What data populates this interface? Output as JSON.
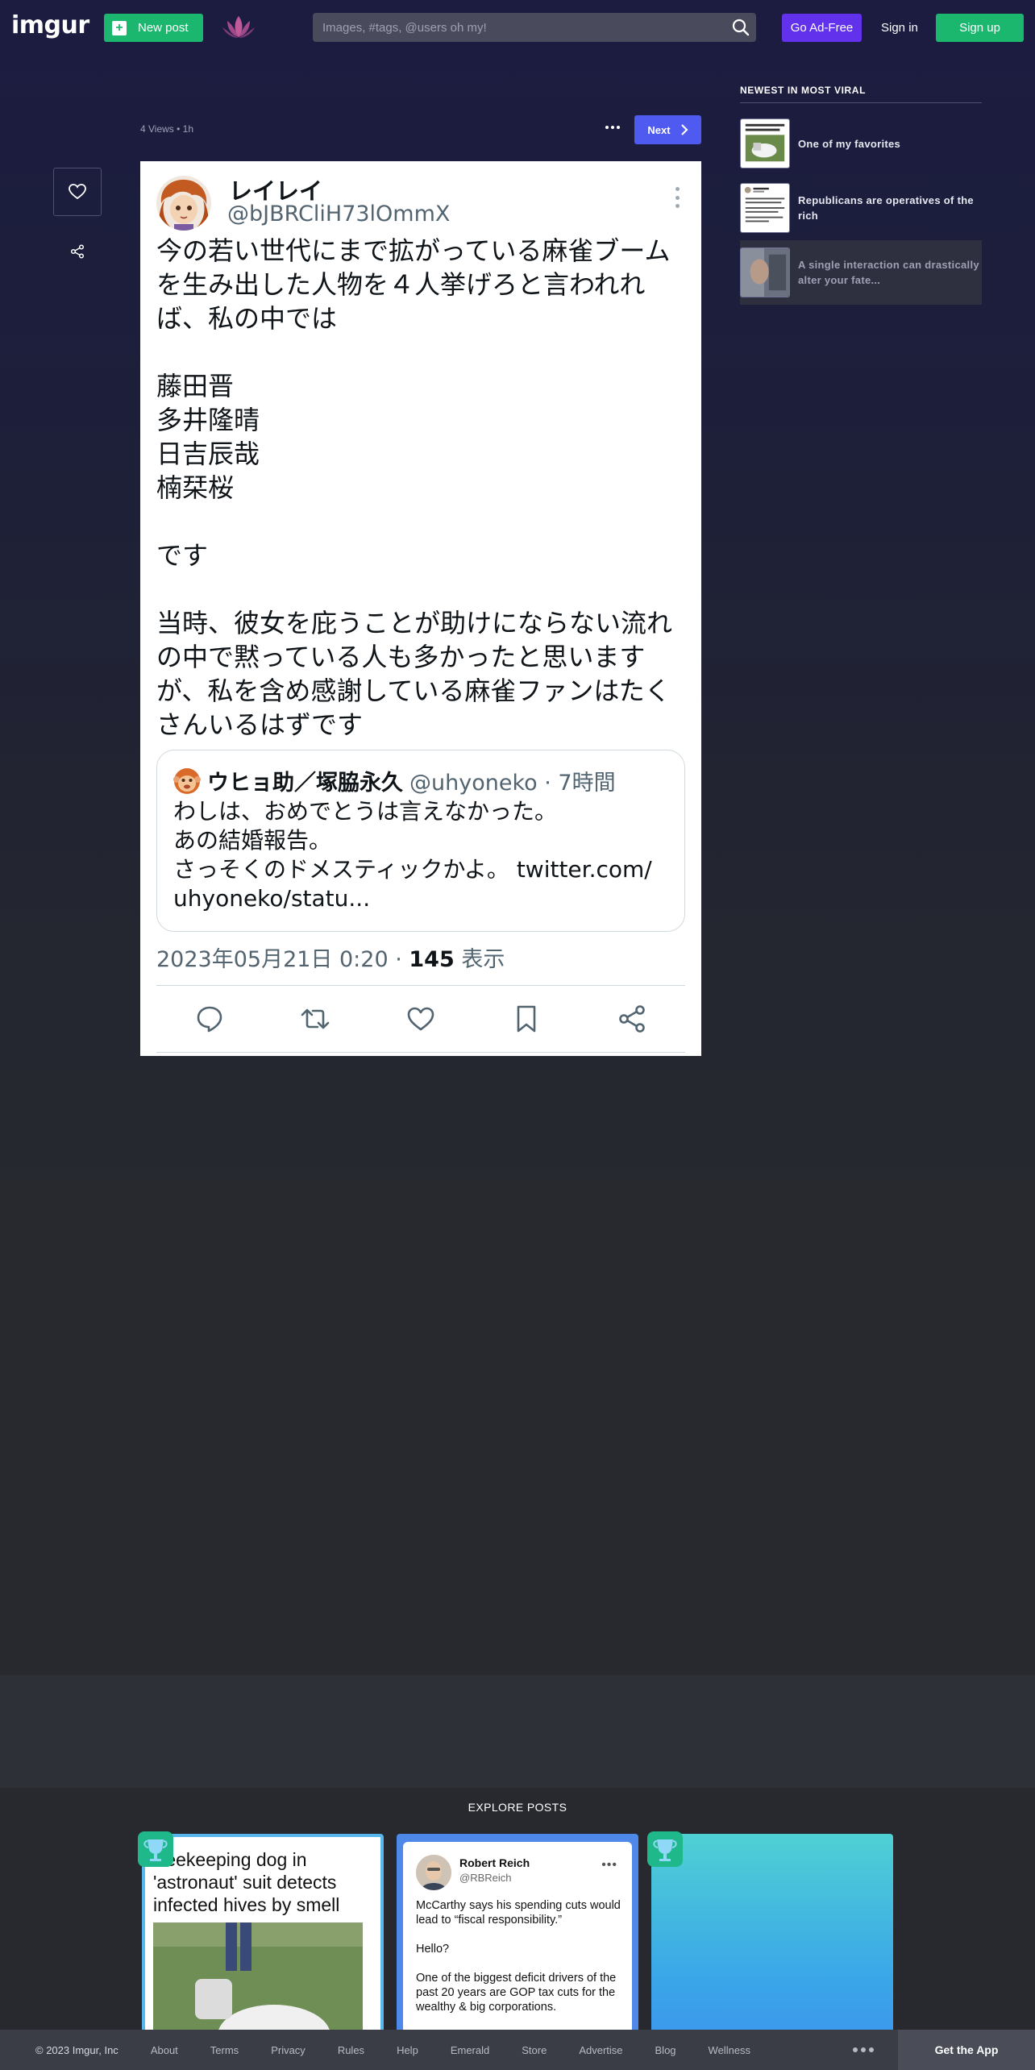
{
  "header": {
    "logo": "imgur",
    "new_post_label": "New post",
    "search_placeholder": "Images, #tags, @users oh my!",
    "ad_free_label": "Go Ad-Free",
    "sign_in_label": "Sign in",
    "sign_up_label": "Sign up"
  },
  "post": {
    "meta": "4 Views • 1h",
    "next_label": "Next"
  },
  "tweet": {
    "name": "レイレイ",
    "handle": "@bJBRCliH73lOmmX",
    "text": "今の若い世代にまで拡がっている麻雀ブームを生み出した人物を４人挙げろと言われれば、私の中では\n\n藤田晋\n多井隆晴\n日吉辰哉\n楠栞桜\n\nです\n\n当時、彼女を庇うことが助けにならない流れの中で黙っている人も多かったと思いますが、私を含め感謝している麻雀ファンはたくさんいるはずです",
    "quote": {
      "name": "ウヒョ助／塚脇永久",
      "handle": "@uhyoneko · 7時間",
      "text": "わしは、おめでとうは言えなかった。\nあの結婚報告。\nさっそくのドメスティックかよ。 twitter.com/\nuhyoneko/statu..."
    },
    "date": "2023年05月21日 0:20 · ",
    "views_count": "145",
    "views_label": " 表示"
  },
  "sidebar": {
    "title": "NEWEST IN MOST VIRAL",
    "items": [
      {
        "label": "One of my favorites"
      },
      {
        "label": "Republicans are operatives of the rich"
      },
      {
        "label": "A single interaction can drastically alter your fate..."
      }
    ]
  },
  "explore": {
    "title": "EXPLORE POSTS",
    "card1_title": "Beekeeping dog in 'astronaut' suit detects infected hives by smell",
    "card2": {
      "name": "Robert Reich",
      "handle": "@RBReich",
      "text": "McCarthy says his spending cuts would lead to “fiscal responsibility.”\n\nHello?\n\nOne of the biggest deficit drivers of the past 20 years are GOP tax cuts for the wealthy & big corporations."
    }
  },
  "footer": {
    "copyright": "© 2023 Imgur, Inc",
    "links": [
      "About",
      "Terms",
      "Privacy",
      "Rules",
      "Help",
      "Emerald",
      "Store",
      "Advertise",
      "Blog",
      "Wellness"
    ],
    "get_app": "Get the App"
  },
  "colors": {
    "brand_green": "#1bb76e",
    "ad_free_purple": "#6131ec",
    "next_blue": "#4e5af0"
  }
}
